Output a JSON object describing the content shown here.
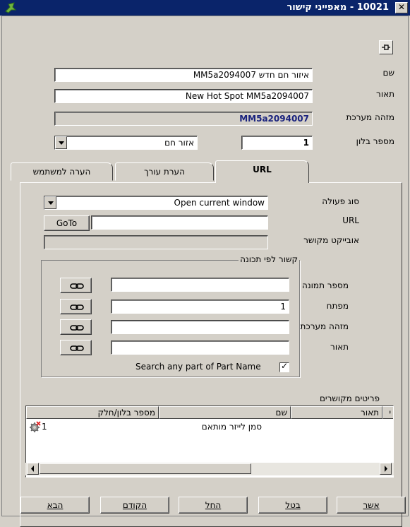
{
  "window": {
    "title": "10021 - מאפייני קישור",
    "close_glyph": "✕"
  },
  "fields": {
    "name_label": "שם",
    "name_value": "איזור חם חדש MM5a2094007",
    "desc_label": "תאור",
    "desc_value": "New Hot Spot MM5a2094007",
    "sysid_label": "מזהה מערכת",
    "sysid_value": "MM5a2094007",
    "balloon_label": "מספר בלון",
    "balloon_value": "1",
    "area_type_value": "אזור חם"
  },
  "tabs": [
    {
      "label": "URL",
      "active": true
    },
    {
      "label": "הערת עורך",
      "active": false
    },
    {
      "label": "הערה למשתמש",
      "active": false
    }
  ],
  "url_tab": {
    "action_type_label": "סוג פעולה",
    "action_type_value": "Open current window",
    "url_label": "URL",
    "goto_label": "GoTo",
    "url_value": "",
    "linked_object_label": "אובייקט מקושר",
    "linked_object_value": "",
    "group_title": "קשור לפי תכונה",
    "attr_rows": [
      {
        "label": "מספר תמונה",
        "value": ""
      },
      {
        "label": "מפתח",
        "value": "1"
      },
      {
        "label": "מזהה מערכת",
        "value": ""
      },
      {
        "label": "תאור",
        "value": ""
      }
    ],
    "search_any_part_label": "Search any part of Part Name",
    "search_any_part_checked": true,
    "check_glyph": "✓"
  },
  "related_items": {
    "title": "פריטים מקושרים",
    "columns": [
      "מספר בלון/חלק",
      "שם",
      "תאור",
      "י"
    ],
    "rows": [
      {
        "balloon": "1",
        "name": "סמן לייזר מותאם",
        "desc": ""
      }
    ]
  },
  "buttons": {
    "ok": "אשר",
    "cancel": "בטל",
    "apply": "החל",
    "previous": "הקודם",
    "next": "הבא"
  }
}
